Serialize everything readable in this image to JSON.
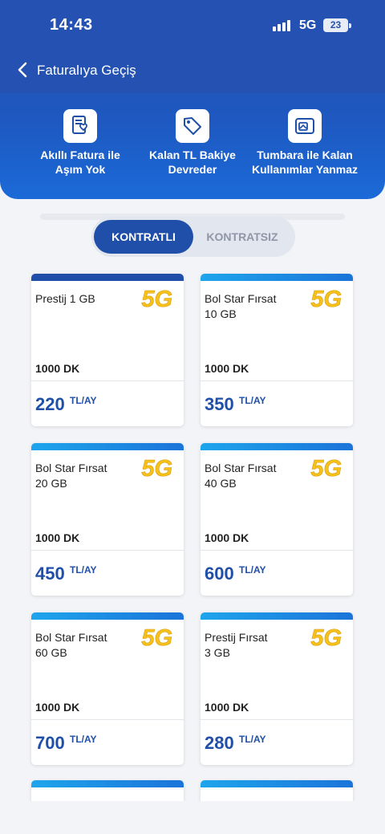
{
  "status_bar": {
    "time": "14:43",
    "network": "5G",
    "battery": "23"
  },
  "nav": {
    "title": "Faturalıya Geçiş"
  },
  "features": [
    {
      "icon": "invoice-heart-icon",
      "line1": "Akıllı Fatura ile",
      "line2": "Aşım Yok"
    },
    {
      "icon": "tag-icon",
      "line1": "Kalan TL Bakiye",
      "line2": "Devreder"
    },
    {
      "icon": "piggy-card-icon",
      "line1": "Tumbara ile Kalan",
      "line2": "Kullanımlar Yanmaz"
    }
  ],
  "tabs": {
    "active": "KONTRATLI",
    "inactive": "KONTRATSIZ"
  },
  "badge": "5G",
  "unit": "TL/AY",
  "colors": {
    "primary": "#1f4fa8",
    "header": "#2552b2",
    "badge_yellow": "#f6c21a"
  },
  "plans": [
    {
      "name_line1": "Prestij 1 GB",
      "name_line2": "",
      "minutes": "1000 DK",
      "price": "220"
    },
    {
      "name_line1": "Bol Star Fırsat",
      "name_line2": "10 GB",
      "minutes": "1000 DK",
      "price": "350"
    },
    {
      "name_line1": "Bol Star Fırsat",
      "name_line2": "20 GB",
      "minutes": "1000 DK",
      "price": "450"
    },
    {
      "name_line1": "Bol Star Fırsat",
      "name_line2": "40 GB",
      "minutes": "1000 DK",
      "price": "600"
    },
    {
      "name_line1": "Bol Star Fırsat",
      "name_line2": "60 GB",
      "minutes": "1000 DK",
      "price": "700"
    },
    {
      "name_line1": "Prestij Fırsat",
      "name_line2": "3 GB",
      "minutes": "1000 DK",
      "price": "280"
    }
  ]
}
